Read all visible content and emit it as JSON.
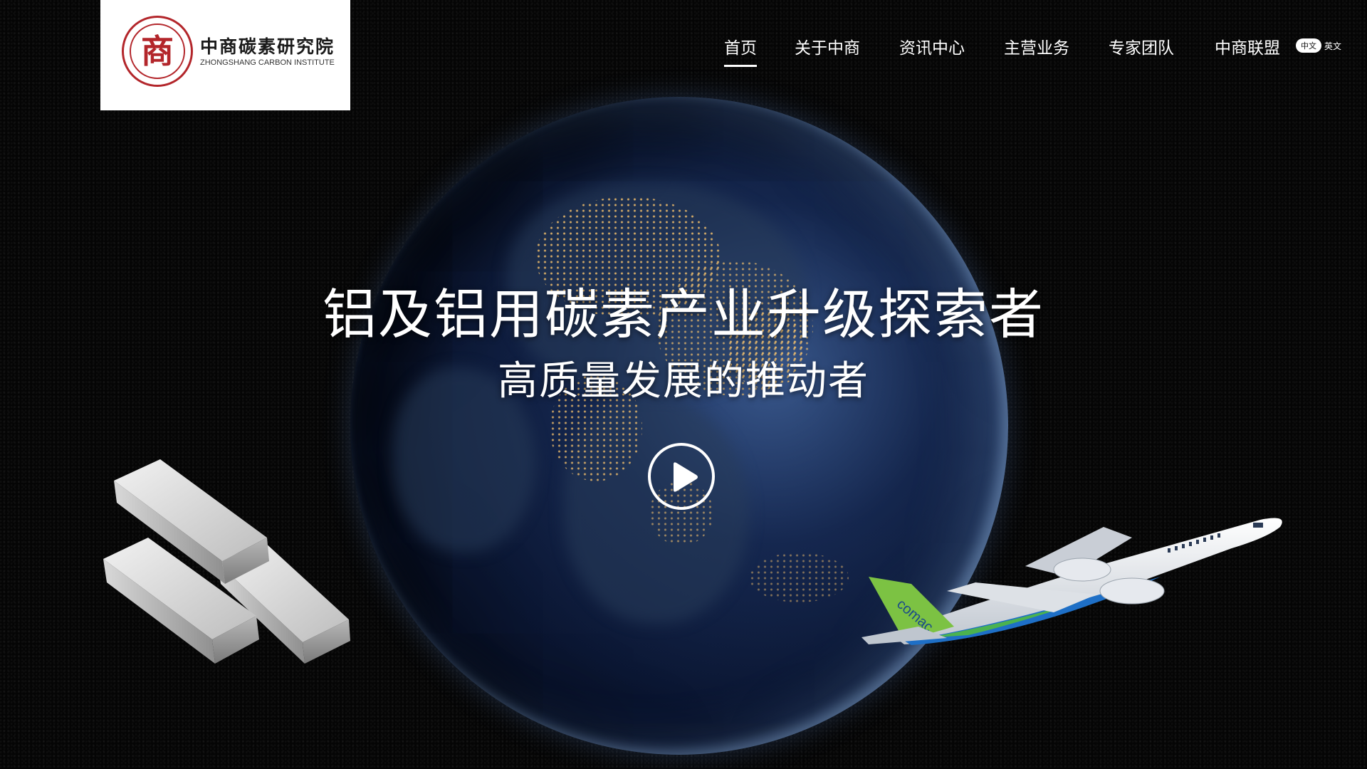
{
  "logo": {
    "seal_char": "商",
    "name_cn": "中商碳素研究院",
    "name_en": "ZHONGSHANG CARBON INSTITUTE"
  },
  "nav": {
    "items": [
      {
        "label": "首页",
        "active": true
      },
      {
        "label": "关于中商",
        "active": false
      },
      {
        "label": "资讯中心",
        "active": false
      },
      {
        "label": "主营业务",
        "active": false
      },
      {
        "label": "专家团队",
        "active": false
      },
      {
        "label": "中商联盟",
        "active": false
      }
    ]
  },
  "language": {
    "current": "中文",
    "alternate": "英文"
  },
  "hero": {
    "title": "铝及铝用碳素产业升级探索者",
    "subtitle": "高质量发展的推动者"
  },
  "icons": {
    "play": "play-icon",
    "ingots": "aluminium-ingot-image",
    "plane": "airplane-image",
    "globe": "earth-globe-image"
  },
  "colors": {
    "brand_red": "#b3262b",
    "background": "#050505",
    "text": "#ffffff"
  },
  "plane_tail_text": "comac"
}
